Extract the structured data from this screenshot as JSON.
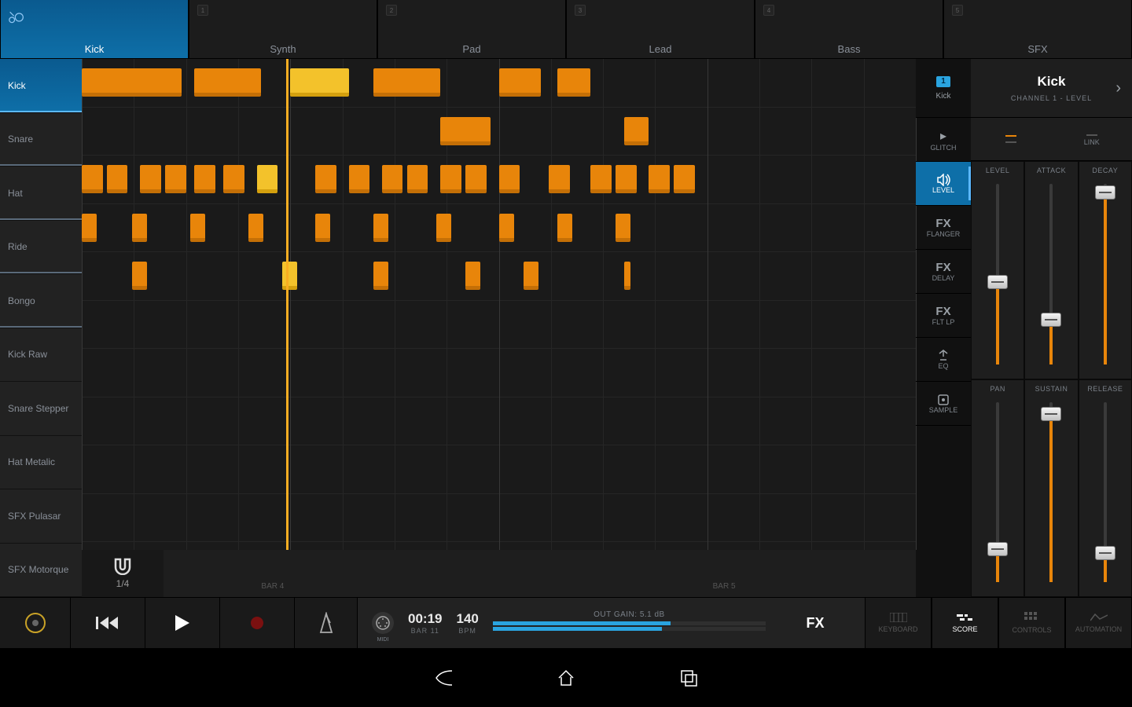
{
  "tracks": [
    {
      "name": "Kick",
      "active": true,
      "icon": "drum",
      "slot": ""
    },
    {
      "name": "Synth",
      "active": false,
      "slot": "1"
    },
    {
      "name": "Pad",
      "active": false,
      "slot": "2"
    },
    {
      "name": "Lead",
      "active": false,
      "slot": "3"
    },
    {
      "name": "Bass",
      "active": false,
      "slot": "4"
    },
    {
      "name": "SFX",
      "active": false,
      "slot": "5"
    }
  ],
  "instruments": [
    {
      "name": "Kick",
      "active": true
    },
    {
      "name": "Snare",
      "active": false
    },
    {
      "name": "Hat",
      "active": false
    },
    {
      "name": "Ride",
      "active": false
    },
    {
      "name": "Bongo",
      "active": false
    },
    {
      "name": "Kick Raw",
      "active": false
    },
    {
      "name": "Snare Stepper",
      "active": false
    },
    {
      "name": "Hat Metalic",
      "active": false
    },
    {
      "name": "SFX Pulasar",
      "active": false
    },
    {
      "name": "SFX Motorque",
      "active": false
    }
  ],
  "quantize": {
    "value": "1/4"
  },
  "notes": {
    "rows": [
      [
        {
          "x": 0,
          "w": 12,
          "y": false
        },
        {
          "x": 13.5,
          "w": 8,
          "y": false
        },
        {
          "x": 25,
          "w": 7,
          "y": true
        },
        {
          "x": 35,
          "w": 8,
          "y": false
        },
        {
          "x": 50,
          "w": 5,
          "y": false
        },
        {
          "x": 57,
          "w": 4,
          "y": false
        }
      ],
      [
        {
          "x": 43,
          "w": 6,
          "y": false
        },
        {
          "x": 65,
          "w": 3,
          "y": false
        }
      ],
      [
        {
          "x": 0,
          "w": 2.5,
          "y": false
        },
        {
          "x": 3,
          "w": 2.5,
          "y": false
        },
        {
          "x": 7,
          "w": 2.5,
          "y": false
        },
        {
          "x": 10,
          "w": 2.5,
          "y": false
        },
        {
          "x": 13.5,
          "w": 2.5,
          "y": false
        },
        {
          "x": 17,
          "w": 2.5,
          "y": false
        },
        {
          "x": 21,
          "w": 2.5,
          "y": true
        },
        {
          "x": 28,
          "w": 2.5,
          "y": false
        },
        {
          "x": 32,
          "w": 2.5,
          "y": false
        },
        {
          "x": 36,
          "w": 2.5,
          "y": false
        },
        {
          "x": 39,
          "w": 2.5,
          "y": false
        },
        {
          "x": 43,
          "w": 2.5,
          "y": false
        },
        {
          "x": 46,
          "w": 2.5,
          "y": false
        },
        {
          "x": 50,
          "w": 2.5,
          "y": false
        },
        {
          "x": 56,
          "w": 2.5,
          "y": false
        },
        {
          "x": 61,
          "w": 2.5,
          "y": false
        },
        {
          "x": 64,
          "w": 2.5,
          "y": false
        },
        {
          "x": 68,
          "w": 2.5,
          "y": false
        },
        {
          "x": 71,
          "w": 2.5,
          "y": false
        }
      ],
      [
        {
          "x": 0,
          "w": 1.8,
          "y": false
        },
        {
          "x": 6,
          "w": 1.8,
          "y": false
        },
        {
          "x": 13,
          "w": 1.8,
          "y": false
        },
        {
          "x": 20,
          "w": 1.8,
          "y": false
        },
        {
          "x": 28,
          "w": 1.8,
          "y": false
        },
        {
          "x": 35,
          "w": 1.8,
          "y": false
        },
        {
          "x": 42.5,
          "w": 1.8,
          "y": false
        },
        {
          "x": 50,
          "w": 1.8,
          "y": false
        },
        {
          "x": 57,
          "w": 1.8,
          "y": false
        },
        {
          "x": 64,
          "w": 1.8,
          "y": false
        }
      ],
      [
        {
          "x": 6,
          "w": 1.8,
          "y": false
        },
        {
          "x": 24,
          "w": 1.8,
          "y": true
        },
        {
          "x": 35,
          "w": 1.8,
          "y": false
        },
        {
          "x": 46,
          "w": 1.8,
          "y": false
        },
        {
          "x": 53,
          "w": 1.8,
          "y": false
        },
        {
          "x": 65,
          "w": 0.8,
          "y": false
        }
      ],
      [],
      [],
      [],
      [],
      []
    ]
  },
  "timeline": {
    "bars": [
      "BAR  4",
      "BAR  5"
    ]
  },
  "playhead": 24.5,
  "rightstrip": {
    "channel": {
      "num": "1",
      "name": "Kick"
    },
    "items": [
      {
        "name": "GLITCH",
        "icon": "glitch",
        "active": false
      },
      {
        "name": "LEVEL",
        "icon": "level",
        "active": true
      },
      {
        "name": "FLANGER",
        "icon": "fx",
        "label": "FX",
        "active": false
      },
      {
        "name": "DELAY",
        "icon": "fx",
        "label": "FX",
        "active": false
      },
      {
        "name": "FLT LP",
        "icon": "fx",
        "label": "FX",
        "active": false
      },
      {
        "name": "EQ",
        "icon": "eq",
        "active": false
      },
      {
        "name": "SAMPLE",
        "icon": "sample",
        "active": false
      }
    ]
  },
  "inspector": {
    "title": "Kick",
    "subtitle": "CHANNEL 1 - LEVEL",
    "linkLabel": "LINK",
    "sliders": [
      {
        "name": "LEVEL",
        "value": 0.48
      },
      {
        "name": "ATTACK",
        "value": 0.28
      },
      {
        "name": "DECAY",
        "value": 0.95
      },
      {
        "name": "PAN",
        "value": 0.22
      },
      {
        "name": "SUSTAIN",
        "value": 0.93
      },
      {
        "name": "RELEASE",
        "value": 0.2
      }
    ]
  },
  "transport": {
    "time": "00:19",
    "timeSub": "BAR  11",
    "bpm": "140",
    "bpmSub": "BPM",
    "gain": "OUT  GAIN:  5.1  dB",
    "meterFill": 0.65,
    "fx": "FX",
    "modes": [
      {
        "name": "KEYBOARD",
        "active": false
      },
      {
        "name": "SCORE",
        "active": true
      },
      {
        "name": "CONTROLS",
        "active": false
      },
      {
        "name": "AUTOMATION",
        "active": false
      }
    ]
  }
}
